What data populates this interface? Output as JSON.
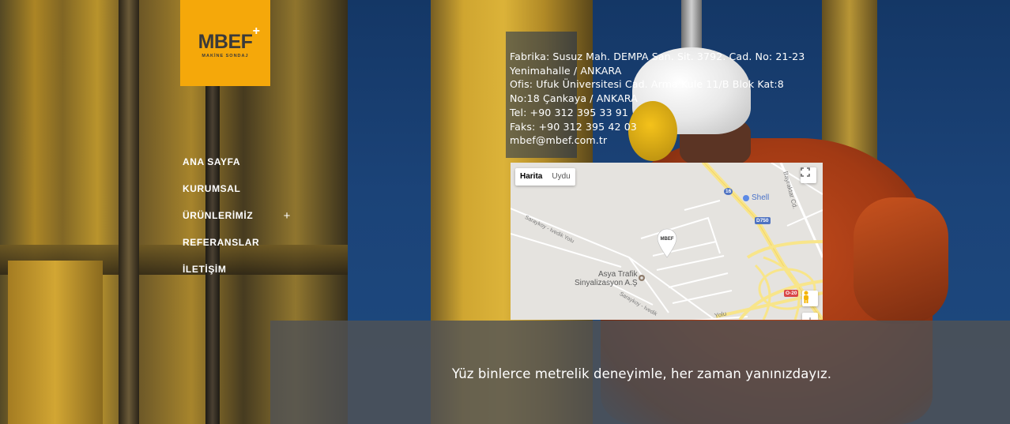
{
  "logo": {
    "word": "MBEF",
    "plus": "+",
    "subtitle": "MAKİNE SONDAJ",
    "bg_color": "#f5a80a"
  },
  "nav": {
    "items": [
      {
        "label": "ANA SAYFA",
        "has_submenu": false
      },
      {
        "label": "KURUMSAL",
        "has_submenu": false
      },
      {
        "label": "ÜRÜNLERİMİZ",
        "has_submenu": true
      },
      {
        "label": "REFERANSLAR",
        "has_submenu": false
      },
      {
        "label": "İLETİŞİM",
        "has_submenu": false
      }
    ],
    "submenu_icon": "+"
  },
  "contact": {
    "lines": [
      "Fabrika: Susuz Mah. DEMPA San. Sit. 3792. Cad. No: 21-23",
      "Yenimahalle / ANKARA",
      "Ofis: Ufuk Üniversitesi Cad. Arma Kule 11/B Blok Kat:8",
      "No:18 Çankaya / ANKARA",
      "Tel: +90 312 395 33 91",
      "Faks: +90 312 395 42 03",
      "mbef@mbef.com.tr"
    ]
  },
  "map": {
    "type_buttons": [
      "Harita",
      "Uydu"
    ],
    "active_type": "Harita",
    "fullscreen_icon": "fullscreen-icon",
    "pegman_icon": "pegman-icon",
    "zoom_in": "+",
    "marker_label": "MBEF",
    "places": {
      "shell": "Shell",
      "asya_line1": "Asya Trafik",
      "asya_line2": "Sinyalizasyon A.Ş"
    },
    "roads": {
      "sarakoy1": "Saraykoy - Ivedik Yolu",
      "sarakoy2": "Saraykoy - Ivedik",
      "bayraktar": "Bayraktar Cd.",
      "yolu": "Yolu",
      "d750": "D750",
      "o20": "O-20",
      "r16": "16"
    }
  },
  "tagline": "Yüz binlerce metrelik deneyimle, her zaman yanınızdayız."
}
